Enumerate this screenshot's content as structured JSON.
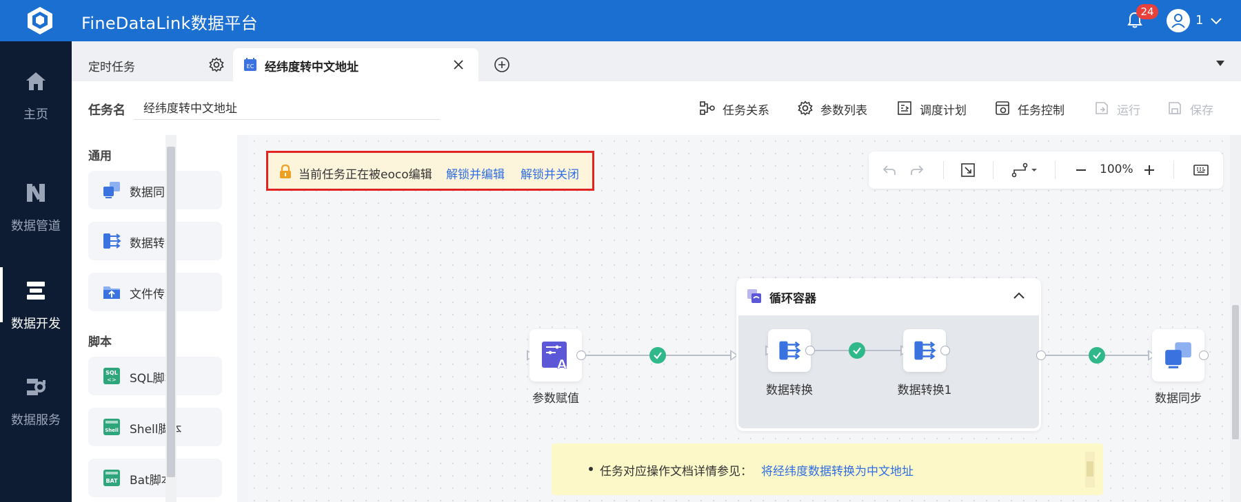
{
  "app": {
    "title": "FineDataLink数据平台",
    "notification_count": "24",
    "user_name": "1"
  },
  "leftnav": [
    {
      "label": "主页",
      "icon": "home-icon"
    },
    {
      "label": "数据管道",
      "icon": "pipeline-icon"
    },
    {
      "label": "数据开发",
      "icon": "dev-icon",
      "active": true
    },
    {
      "label": "数据服务",
      "icon": "service-icon"
    }
  ],
  "tabs": [
    {
      "label": "定时任务"
    },
    {
      "label": "经纬度转中文地址",
      "active": true
    }
  ],
  "task": {
    "name_label": "任务名",
    "name_value": "经纬度转中文地址",
    "tools": [
      {
        "label": "任务关系",
        "icon": "relation-icon"
      },
      {
        "label": "参数列表",
        "icon": "gear-icon"
      },
      {
        "label": "调度计划",
        "icon": "schedule-icon"
      },
      {
        "label": "任务控制",
        "icon": "control-icon"
      },
      {
        "label": "运行",
        "icon": "run-icon",
        "disabled": true
      },
      {
        "label": "保存",
        "icon": "save-icon",
        "disabled": true
      }
    ]
  },
  "palette": {
    "section_general": "通用",
    "general": [
      "数据同步",
      "数据转换",
      "文件传输"
    ],
    "section_script": "脚本",
    "script": [
      "SQL脚本",
      "Shell脚本",
      "Bat脚本"
    ]
  },
  "lock_notice": {
    "message": "当前任务正在被eoco编辑",
    "unlock_edit": "解锁并编辑",
    "unlock_close": "解锁并关闭"
  },
  "canvas_controls": {
    "zoom": "100%"
  },
  "nodes": {
    "param": "参数赋值",
    "loop_title": "循环容器",
    "transform1": "数据转换",
    "transform2": "数据转换1",
    "sync": "数据同步"
  },
  "note": {
    "text": "任务对应操作文档详情参见：",
    "link": "将经纬度数据转换为中文地址"
  },
  "colors": {
    "topbar": "#1a6fd1",
    "nav": "#0d1b33",
    "accent": "#2f6ee4",
    "success": "#2fb889",
    "alert_border": "#e32222"
  }
}
